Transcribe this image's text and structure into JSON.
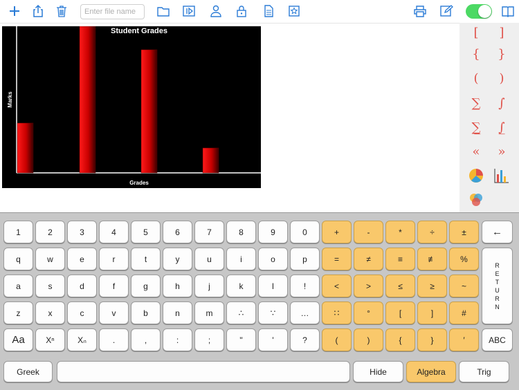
{
  "toolbar": {
    "file_placeholder": "Enter file name",
    "icons": [
      "plus-icon",
      "share-icon",
      "trash-icon",
      "folder-icon",
      "play-icon",
      "person-icon",
      "lock-icon",
      "document-icon",
      "star-icon",
      "print-icon",
      "edit-icon",
      "book-icon"
    ],
    "toggle_on": true,
    "accent": "#2a7bd6"
  },
  "chart_data": {
    "type": "bar",
    "title": "Student Grades",
    "xlabel": "Grades",
    "ylabel": "Marks",
    "values": [
      34,
      100,
      84,
      17
    ],
    "ylim": [
      0,
      100
    ],
    "bar_color": "#cc0000",
    "background": "#000000"
  },
  "symbols": {
    "rows": [
      [
        "[",
        "]"
      ],
      [
        "{",
        "}"
      ],
      [
        "(",
        ")"
      ],
      [
        "∑",
        "∫"
      ],
      [
        "∑̲",
        "∫̲"
      ],
      [
        "«",
        "»"
      ]
    ],
    "icons": [
      "pie-chart-icon",
      "bar-chart-icon",
      "venn-icon"
    ]
  },
  "keyboard": {
    "row1": [
      "1",
      "2",
      "3",
      "4",
      "5",
      "6",
      "7",
      "8",
      "9",
      "0"
    ],
    "row1_sym": [
      "+",
      "-",
      "*",
      "÷",
      "±"
    ],
    "backspace": "←",
    "row2": [
      "q",
      "w",
      "e",
      "r",
      "t",
      "y",
      "u",
      "i",
      "o",
      "p"
    ],
    "row2_sym": [
      "=",
      "≠",
      "≡",
      "≢",
      "%"
    ],
    "row3": [
      "a",
      "s",
      "d",
      "f",
      "g",
      "h",
      "j",
      "k",
      "l",
      "!"
    ],
    "row3_sym": [
      "<",
      ">",
      "≤",
      "≥",
      "~"
    ],
    "row4": [
      "z",
      "x",
      "c",
      "v",
      "b",
      "n",
      "m",
      "∴",
      "∵",
      "…"
    ],
    "row4_sym": [
      "∷",
      "°",
      "[",
      "]",
      "#"
    ],
    "return_letters": [
      "R",
      "E",
      "T",
      "U",
      "R",
      "N"
    ],
    "row5_case": "Aa",
    "row5_sup": "Xⁿ",
    "row5_sub": "Xₙ",
    "row5": [
      ".",
      ",",
      ":",
      ";",
      "\"",
      "'",
      "?"
    ],
    "row5_sym": [
      "(",
      ")",
      "{",
      "}",
      "′"
    ],
    "abc": "ABC",
    "greek": "Greek",
    "hide": "Hide",
    "algebra": "Algebra",
    "trig": "Trig"
  }
}
